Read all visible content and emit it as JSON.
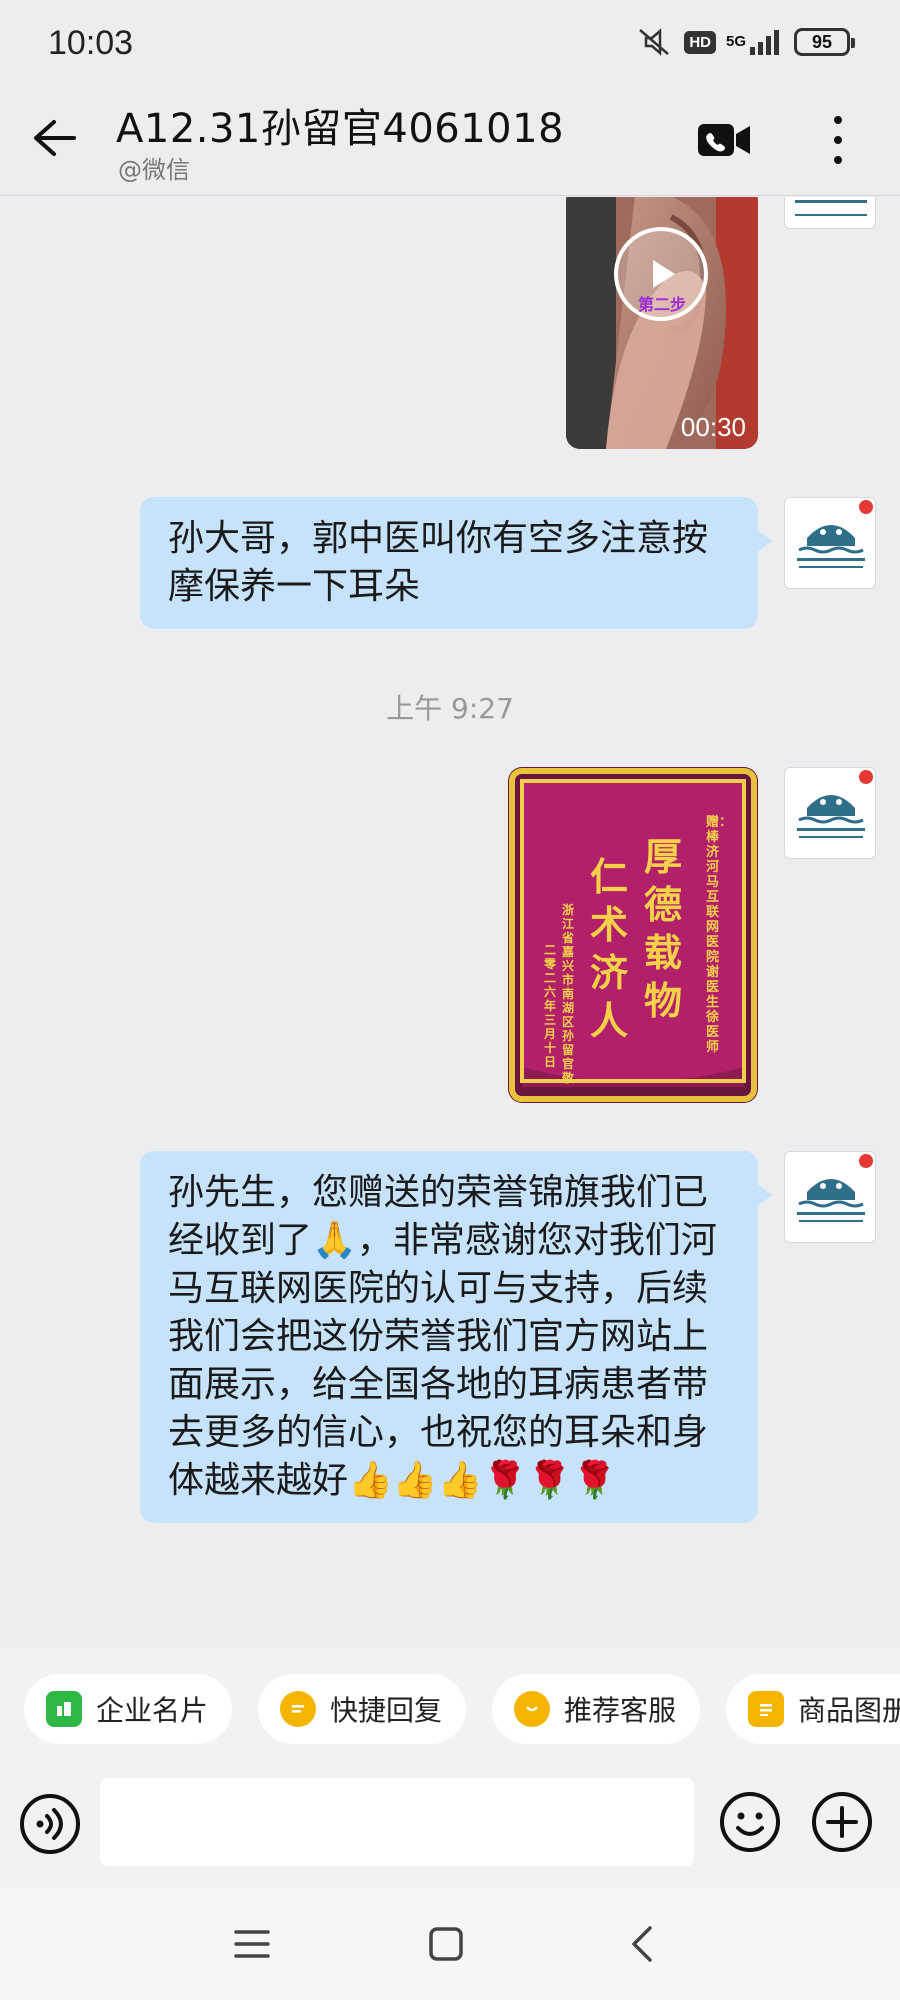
{
  "status_bar": {
    "time": "10:03",
    "hd": "HD",
    "network": "5G",
    "battery": "95"
  },
  "header": {
    "title": "A12.31孙留官4061018",
    "subtitle": "@微信"
  },
  "messages": [
    {
      "type": "video",
      "duration": "00:30",
      "overlay_text": "第二步"
    },
    {
      "type": "text",
      "text": "孙大哥，郭中医叫你有空多注意按摩保养一下耳朵"
    },
    {
      "type": "time",
      "text": "上午 9:27"
    },
    {
      "type": "image",
      "banner": {
        "recipient": "赠：棒济河马互联网医院 谢医生 徐医师",
        "line_right": "厚德载物",
        "line_left": "仁术济人",
        "sender": "浙江省嘉兴市南湖区 孙留官 敬",
        "date": "二零二六年三月十日"
      }
    },
    {
      "type": "text",
      "text": "孙先生，您赠送的荣誉锦旗我们已经收到了🙏，非常感谢您对我们河马互联网医院的认可与支持，后续我们会把这份荣誉我们官方网站上面展示，给全国各地的耳病患者带去更多的信心，也祝您的耳朵和身体越来越好👍👍👍🌹🌹🌹"
    }
  ],
  "quick_actions": [
    {
      "label": "企业名片",
      "color": "#2db843"
    },
    {
      "label": "快捷回复",
      "color": "#f5b400"
    },
    {
      "label": "推荐客服",
      "color": "#f5b400"
    },
    {
      "label": "商品图册",
      "color": "#f5b400"
    }
  ],
  "input": {
    "placeholder": ""
  },
  "icons": {
    "back": "back-arrow-icon",
    "video_call": "video-call-icon",
    "more": "more-vertical-icon",
    "voice": "voice-icon",
    "emoji": "emoji-icon",
    "plus": "plus-icon",
    "menu": "menu-icon",
    "home": "home-square-icon",
    "nav_back": "nav-back-icon"
  }
}
